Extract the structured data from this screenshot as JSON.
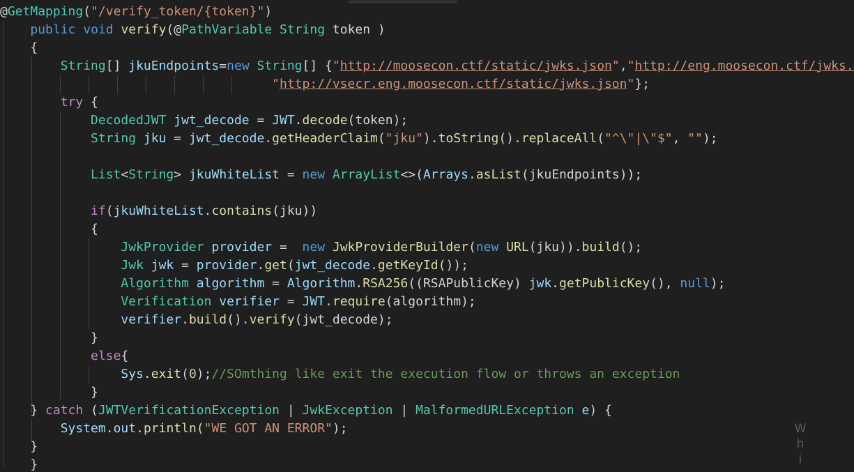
{
  "editor": {
    "language": "java",
    "theme_colors": {
      "background": "#1f1f1f",
      "text": "#d4d4d4",
      "annotation": "#4ec9b0",
      "string": "#ce9178",
      "keyword": "#569cd6",
      "control": "#c586c0",
      "type": "#4ec9b0",
      "function": "#dcdcaa",
      "variable": "#9cdcfe",
      "number": "#b5cea8",
      "comment": "#6a9955"
    },
    "lines": [
      [
        [
          "deco",
          "@"
        ],
        [
          "anno",
          "GetMapping"
        ],
        [
          "plain",
          "("
        ],
        [
          "str",
          "\"/verify_token/{token}\""
        ],
        [
          "plain",
          ")"
        ]
      ],
      [
        [
          "plain",
          "    "
        ],
        [
          "kw",
          "public"
        ],
        [
          "plain",
          " "
        ],
        [
          "kw",
          "void"
        ],
        [
          "plain",
          " "
        ],
        [
          "fn",
          "verify"
        ],
        [
          "plain",
          "(@"
        ],
        [
          "anno",
          "PathVariable"
        ],
        [
          "plain",
          " "
        ],
        [
          "type",
          "String"
        ],
        [
          "plain",
          " token )"
        ]
      ],
      [
        [
          "plain",
          "    {"
        ]
      ],
      [
        [
          "plain",
          "        "
        ],
        [
          "type",
          "String"
        ],
        [
          "plain",
          "[] "
        ],
        [
          "var",
          "jkuEndpoints"
        ],
        [
          "op",
          "="
        ],
        [
          "kw",
          "new"
        ],
        [
          "plain",
          " "
        ],
        [
          "type",
          "String"
        ],
        [
          "plain",
          "[] {"
        ],
        [
          "str",
          "\""
        ],
        [
          "url",
          "http://moosecon.ctf/static/jwks.json"
        ],
        [
          "str",
          "\""
        ],
        [
          "plain",
          ","
        ],
        [
          "str",
          "\""
        ],
        [
          "url",
          "http://eng.moosecon.ctf/jwks.json"
        ],
        [
          "str",
          "\""
        ]
      ],
      [
        [
          "plain",
          "                                    "
        ],
        [
          "str",
          "\""
        ],
        [
          "url",
          "http://vsecr.eng.moosecon.ctf/static/jwks.json"
        ],
        [
          "str",
          "\""
        ],
        [
          "plain",
          "};"
        ]
      ],
      [
        [
          "plain",
          "        "
        ],
        [
          "ctl",
          "try"
        ],
        [
          "plain",
          " {"
        ]
      ],
      [
        [
          "plain",
          "            "
        ],
        [
          "type",
          "DecodedJWT"
        ],
        [
          "plain",
          " "
        ],
        [
          "var",
          "jwt_decode"
        ],
        [
          "plain",
          " = "
        ],
        [
          "var",
          "JWT"
        ],
        [
          "plain",
          "."
        ],
        [
          "fn",
          "decode"
        ],
        [
          "plain",
          "(token);"
        ]
      ],
      [
        [
          "plain",
          "            "
        ],
        [
          "type",
          "String"
        ],
        [
          "plain",
          " "
        ],
        [
          "var",
          "jku"
        ],
        [
          "plain",
          " = "
        ],
        [
          "var",
          "jwt_decode"
        ],
        [
          "plain",
          "."
        ],
        [
          "fn",
          "getHeaderClaim"
        ],
        [
          "plain",
          "("
        ],
        [
          "str",
          "\"jku\""
        ],
        [
          "plain",
          ")."
        ],
        [
          "fn",
          "toString"
        ],
        [
          "plain",
          "()."
        ],
        [
          "fn",
          "replaceAll"
        ],
        [
          "plain",
          "("
        ],
        [
          "str",
          "\"^\\\"|\\\"$\""
        ],
        [
          "plain",
          ", "
        ],
        [
          "str",
          "\"\""
        ],
        [
          "plain",
          ");"
        ]
      ],
      [
        [
          "plain",
          ""
        ]
      ],
      [
        [
          "plain",
          "            "
        ],
        [
          "type",
          "List"
        ],
        [
          "plain",
          "<"
        ],
        [
          "type",
          "String"
        ],
        [
          "plain",
          "> "
        ],
        [
          "var",
          "jkuWhiteList"
        ],
        [
          "plain",
          " = "
        ],
        [
          "kw",
          "new"
        ],
        [
          "plain",
          " "
        ],
        [
          "type",
          "ArrayList"
        ],
        [
          "plain",
          "<>("
        ],
        [
          "var",
          "Arrays"
        ],
        [
          "plain",
          "."
        ],
        [
          "fn",
          "asList"
        ],
        [
          "plain",
          "(jkuEndpoints));"
        ]
      ],
      [
        [
          "plain",
          ""
        ]
      ],
      [
        [
          "plain",
          "            "
        ],
        [
          "ctl",
          "if"
        ],
        [
          "plain",
          "("
        ],
        [
          "var",
          "jkuWhiteList"
        ],
        [
          "plain",
          "."
        ],
        [
          "fn",
          "contains"
        ],
        [
          "plain",
          "(jku))"
        ]
      ],
      [
        [
          "plain",
          "            {"
        ]
      ],
      [
        [
          "plain",
          "                "
        ],
        [
          "type",
          "JwkProvider"
        ],
        [
          "plain",
          " "
        ],
        [
          "var",
          "provider"
        ],
        [
          "plain",
          " =  "
        ],
        [
          "kw",
          "new"
        ],
        [
          "plain",
          " "
        ],
        [
          "fn",
          "JwkProviderBuilder"
        ],
        [
          "plain",
          "("
        ],
        [
          "kw",
          "new"
        ],
        [
          "plain",
          " "
        ],
        [
          "fn",
          "URL"
        ],
        [
          "plain",
          "(jku))."
        ],
        [
          "fn",
          "build"
        ],
        [
          "plain",
          "();"
        ]
      ],
      [
        [
          "plain",
          "                "
        ],
        [
          "type",
          "Jwk"
        ],
        [
          "plain",
          " "
        ],
        [
          "var",
          "jwk"
        ],
        [
          "plain",
          " = "
        ],
        [
          "var",
          "provider"
        ],
        [
          "plain",
          "."
        ],
        [
          "fn",
          "get"
        ],
        [
          "plain",
          "("
        ],
        [
          "var",
          "jwt_decode"
        ],
        [
          "plain",
          "."
        ],
        [
          "fn",
          "getKeyId"
        ],
        [
          "plain",
          "());"
        ]
      ],
      [
        [
          "plain",
          "                "
        ],
        [
          "type",
          "Algorithm"
        ],
        [
          "plain",
          " "
        ],
        [
          "var",
          "algorithm"
        ],
        [
          "plain",
          " = "
        ],
        [
          "var",
          "Algorithm"
        ],
        [
          "plain",
          "."
        ],
        [
          "fn",
          "RSA256"
        ],
        [
          "plain",
          "((RSAPublicKey) "
        ],
        [
          "var",
          "jwk"
        ],
        [
          "plain",
          "."
        ],
        [
          "fn",
          "getPublicKey"
        ],
        [
          "plain",
          "(), "
        ],
        [
          "kw",
          "null"
        ],
        [
          "plain",
          ");"
        ]
      ],
      [
        [
          "plain",
          "                "
        ],
        [
          "type",
          "Verification"
        ],
        [
          "plain",
          " "
        ],
        [
          "var",
          "verifier"
        ],
        [
          "plain",
          " = "
        ],
        [
          "var",
          "JWT"
        ],
        [
          "plain",
          "."
        ],
        [
          "fn",
          "require"
        ],
        [
          "plain",
          "(algorithm);"
        ]
      ],
      [
        [
          "plain",
          "                "
        ],
        [
          "var",
          "verifier"
        ],
        [
          "plain",
          "."
        ],
        [
          "fn",
          "build"
        ],
        [
          "plain",
          "()."
        ],
        [
          "fn",
          "verify"
        ],
        [
          "plain",
          "(jwt_decode);"
        ]
      ],
      [
        [
          "plain",
          "            }"
        ]
      ],
      [
        [
          "plain",
          "            "
        ],
        [
          "ctl",
          "else"
        ],
        [
          "plain",
          "{"
        ]
      ],
      [
        [
          "plain",
          "                "
        ],
        [
          "var",
          "Sys"
        ],
        [
          "plain",
          "."
        ],
        [
          "fn",
          "exit"
        ],
        [
          "plain",
          "("
        ],
        [
          "num",
          "0"
        ],
        [
          "plain",
          ");"
        ],
        [
          "cmt",
          "//SOmthing like exit the execution flow or throws an exception"
        ]
      ],
      [
        [
          "plain",
          "            }"
        ]
      ],
      [
        [
          "plain",
          "    } "
        ],
        [
          "ctl",
          "catch"
        ],
        [
          "plain",
          " ("
        ],
        [
          "type",
          "JWTVerificationException"
        ],
        [
          "plain",
          " | "
        ],
        [
          "type",
          "JwkException"
        ],
        [
          "plain",
          " | "
        ],
        [
          "type",
          "MalformedURLException"
        ],
        [
          "plain",
          " "
        ],
        [
          "var",
          "e"
        ],
        [
          "plain",
          ") {"
        ]
      ],
      [
        [
          "plain",
          "        "
        ],
        [
          "var",
          "System"
        ],
        [
          "plain",
          "."
        ],
        [
          "var",
          "out"
        ],
        [
          "plain",
          "."
        ],
        [
          "fn",
          "println"
        ],
        [
          "plain",
          "("
        ],
        [
          "str",
          "\"WE GOT AN ERROR\""
        ],
        [
          "plain",
          ");"
        ]
      ],
      [
        [
          "plain",
          "    }"
        ]
      ],
      [
        [
          "plain",
          "    }"
        ]
      ]
    ]
  },
  "watermark": {
    "letters": [
      "W",
      "h",
      "i"
    ]
  }
}
